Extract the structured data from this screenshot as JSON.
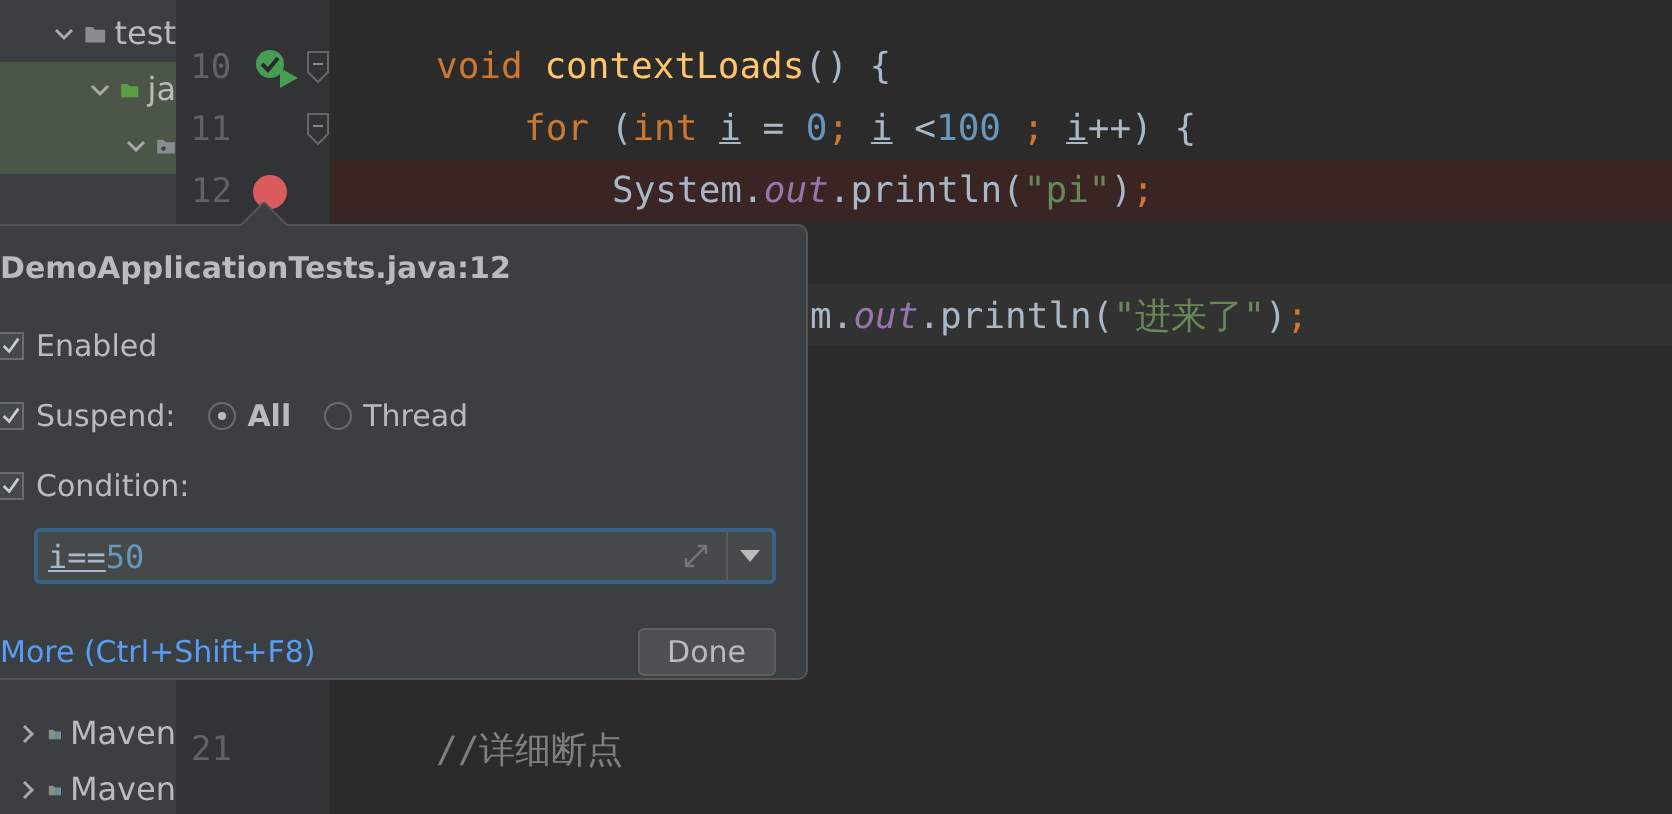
{
  "project_tree": {
    "top": [
      {
        "label": "test",
        "expanded": true,
        "selected": false,
        "children": [
          {
            "label": "ja",
            "expanded": true,
            "selected": true,
            "children": [
              {
                "expanded": true,
                "selected": true
              }
            ]
          }
        ]
      }
    ],
    "bottom": [
      {
        "label": "Maven",
        "expanded": false,
        "selected": false
      },
      {
        "label": "Maven",
        "expanded": false,
        "selected": false
      }
    ]
  },
  "editor": {
    "top_lines": [
      {
        "number": "10",
        "run_marker": true,
        "fold": true,
        "tokens": [
          {
            "text": "void ",
            "kind": "keyword"
          },
          {
            "text": "contextLoads",
            "kind": "method"
          },
          {
            "text": "() {",
            "kind": "plain"
          }
        ],
        "children": [
          {
            "number": "11",
            "fold": true,
            "tokens": [
              {
                "text": "for ",
                "kind": "keyword"
              },
              {
                "text": "(",
                "kind": "plain"
              },
              {
                "text": "int ",
                "kind": "keyword"
              },
              {
                "text": "i",
                "kind": "var"
              },
              {
                "text": " = ",
                "kind": "plain"
              },
              {
                "text": "0",
                "kind": "number"
              },
              {
                "text": "; ",
                "kind": "keyword"
              },
              {
                "text": "i",
                "kind": "var"
              },
              {
                "text": " <",
                "kind": "plain"
              },
              {
                "text": "100",
                "kind": "number"
              },
              {
                "text": " ; ",
                "kind": "keyword"
              },
              {
                "text": "i",
                "kind": "var"
              },
              {
                "text": "++) {",
                "kind": "plain"
              }
            ],
            "children": [
              {
                "number": "12",
                "breakpoint": true,
                "tokens": [
                  {
                    "text": "System.",
                    "kind": "plain"
                  },
                  {
                    "text": "out",
                    "kind": "field"
                  },
                  {
                    "text": ".println(",
                    "kind": "plain"
                  },
                  {
                    "text": "\"pi\"",
                    "kind": "string"
                  },
                  {
                    "text": ")",
                    "kind": "plain"
                  },
                  {
                    "text": ";",
                    "kind": "keyword"
                  }
                ]
              }
            ]
          }
        ]
      }
    ],
    "current_line": {
      "tokens": [
        {
          "text": "m.",
          "kind": "plain"
        },
        {
          "text": "out",
          "kind": "field"
        },
        {
          "text": ".println(",
          "kind": "plain"
        },
        {
          "text": "\"进来了\"",
          "kind": "string"
        },
        {
          "text": ")",
          "kind": "plain"
        },
        {
          "text": ";",
          "kind": "keyword"
        }
      ]
    },
    "bottom_lines": [
      {
        "number": "21",
        "tokens": [
          {
            "text": "//详细断点",
            "kind": "comment"
          }
        ]
      }
    ]
  },
  "breakpoint_popup": {
    "title": "DemoApplicationTests.java:12",
    "enabled": {
      "label": "Enabled",
      "checked": true
    },
    "suspend": {
      "label": "Suspend:",
      "checked": true,
      "options": [
        {
          "label": "All",
          "selected": true
        },
        {
          "label": "Thread",
          "selected": false
        }
      ]
    },
    "condition": {
      "label": "Condition:",
      "checked": true,
      "value": "i==50"
    },
    "more_link": "More (Ctrl+Shift+F8)",
    "done_button": "Done"
  }
}
